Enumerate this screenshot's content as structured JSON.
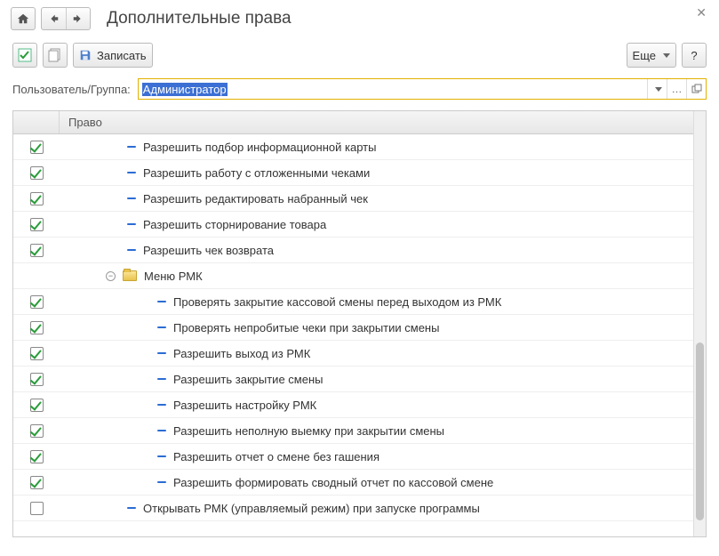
{
  "header": {
    "title": "Дополнительные права"
  },
  "toolbar": {
    "save_label": "Записать",
    "more_label": "Еще",
    "help_label": "?"
  },
  "userRow": {
    "label": "Пользователь/Группа:",
    "value": "Администратор"
  },
  "table": {
    "header_right": "Право",
    "rows": [
      {
        "type": "item",
        "level": 1,
        "checked": true,
        "text": "Разрешить подбор информационной карты"
      },
      {
        "type": "item",
        "level": 1,
        "checked": true,
        "text": "Разрешить работу с отложенными чеками"
      },
      {
        "type": "item",
        "level": 1,
        "checked": true,
        "text": "Разрешить редактировать набранный чек"
      },
      {
        "type": "item",
        "level": 1,
        "checked": true,
        "text": "Разрешить сторнирование товара"
      },
      {
        "type": "item",
        "level": 1,
        "checked": true,
        "text": "Разрешить чек возврата"
      },
      {
        "type": "group",
        "level": 0,
        "text": "Меню РМК"
      },
      {
        "type": "item",
        "level": 2,
        "checked": true,
        "text": "Проверять закрытие кассовой смены перед выходом из РМК"
      },
      {
        "type": "item",
        "level": 2,
        "checked": true,
        "text": "Проверять непробитые чеки при закрытии смены"
      },
      {
        "type": "item",
        "level": 2,
        "checked": true,
        "text": "Разрешить выход из РМК"
      },
      {
        "type": "item",
        "level": 2,
        "checked": true,
        "text": "Разрешить закрытие смены"
      },
      {
        "type": "item",
        "level": 2,
        "checked": true,
        "text": "Разрешить настройку РМК"
      },
      {
        "type": "item",
        "level": 2,
        "checked": true,
        "text": "Разрешить неполную выемку при закрытии смены"
      },
      {
        "type": "item",
        "level": 2,
        "checked": true,
        "text": "Разрешить отчет о смене без гашения"
      },
      {
        "type": "item",
        "level": 2,
        "checked": true,
        "text": "Разрешить формировать сводный отчет по кассовой смене"
      },
      {
        "type": "item",
        "level": 1,
        "checked": false,
        "text": "Открывать РМК (управляемый режим) при запуске программы"
      }
    ]
  }
}
